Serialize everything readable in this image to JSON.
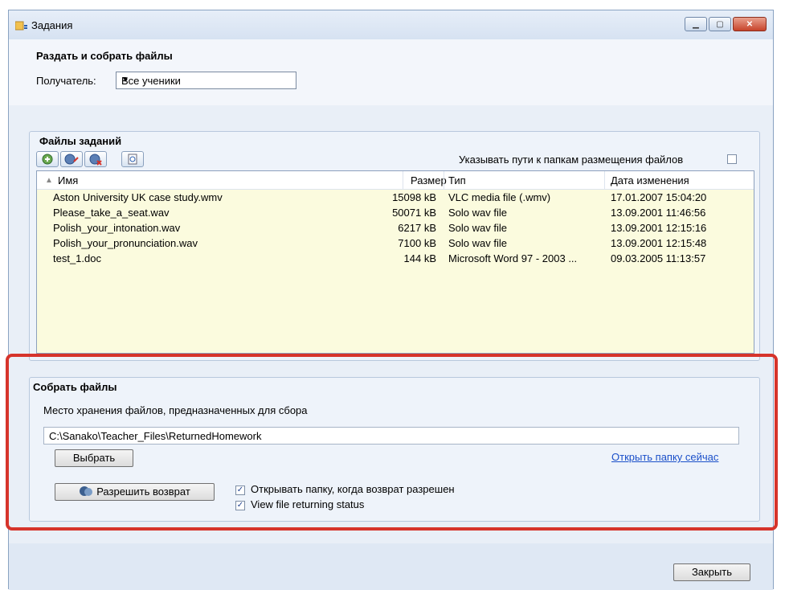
{
  "window": {
    "title": "Задания",
    "controls": {
      "minimize": "▁",
      "maximize": "▢",
      "close": "✕"
    }
  },
  "distribute": {
    "heading": "Раздать и собрать файлы",
    "recipient_label": "Получатель:",
    "recipient_value": "Все ученики"
  },
  "task_files": {
    "heading": "Файлы заданий",
    "show_paths_label": "Указывать пути к папкам размещения файлов",
    "show_paths_checked": false,
    "toolbar_icons": [
      "add-file-icon",
      "add-folder-icon",
      "remove-file-icon",
      "preview-icon"
    ],
    "columns": [
      "Имя",
      "Размер",
      "Тип",
      "Дата изменения"
    ],
    "rows": [
      {
        "name": "Aston University UK case study.wmv",
        "size": "15098 kB",
        "type": "VLC media file (.wmv)",
        "date": "17.01.2007 15:04:20"
      },
      {
        "name": "Please_take_a_seat.wav",
        "size": "50071 kB",
        "type": "Solo wav file",
        "date": "13.09.2001 11:46:56"
      },
      {
        "name": "Polish_your_intonation.wav",
        "size": "6217 kB",
        "type": "Solo wav file",
        "date": "13.09.2001 12:15:16"
      },
      {
        "name": "Polish_your_pronunciation.wav",
        "size": "7100 kB",
        "type": "Solo wav file",
        "date": "13.09.2001 12:15:48"
      },
      {
        "name": "test_1.doc",
        "size": "144 kB",
        "type": "Microsoft Word 97 - 2003 ...",
        "date": "09.03.2005 11:13:57"
      }
    ]
  },
  "collect": {
    "heading": "Собрать файлы",
    "location_label": "Место хранения файлов, предназначенных для сбора",
    "path_value": "C:\\Sanako\\Teacher_Files\\ReturnedHomework",
    "choose_button": "Выбрать",
    "open_folder_link": "Открыть папку сейчас",
    "allow_return_button": "Разрешить возврат",
    "open_folder_checkbox_label": "Открывать папку, когда возврат разрешен",
    "open_folder_checked": true,
    "view_status_checkbox_label": "View file returning status",
    "view_status_checked": true
  },
  "footer": {
    "close_button": "Закрыть"
  },
  "colors": {
    "highlight": "#d6342b",
    "list_background": "#fbfbde",
    "link": "#1a4fc9"
  }
}
